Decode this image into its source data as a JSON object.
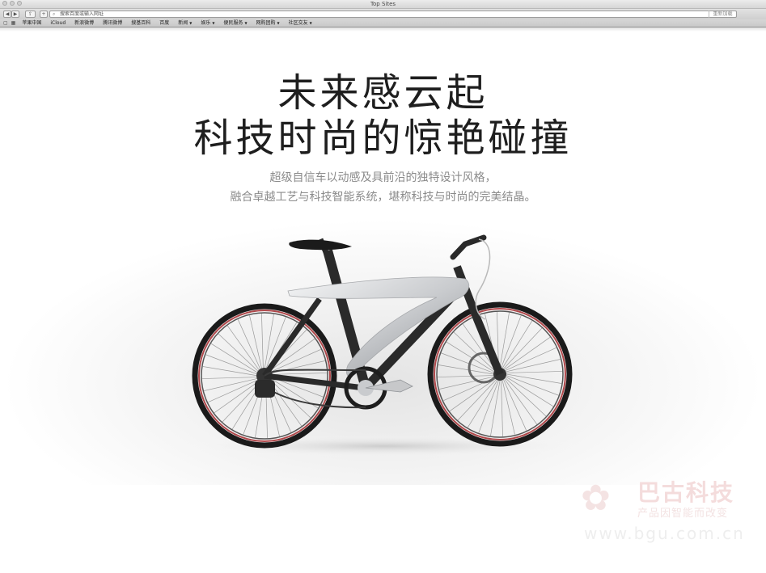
{
  "window": {
    "title": "Top Sites"
  },
  "toolbar": {
    "back_glyph": "◀",
    "forward_glyph": "▶",
    "share_glyph": "⇪",
    "add_glyph": "+",
    "address_placeholder": "搜索百度或输入网址",
    "right_button": "重新加载"
  },
  "bookmarks": {
    "items": [
      {
        "label": "苹果中国",
        "menu": false
      },
      {
        "label": "iCloud",
        "menu": false
      },
      {
        "label": "新浪微博",
        "menu": false
      },
      {
        "label": "腾讯微博",
        "menu": false
      },
      {
        "label": "搜基百科",
        "menu": false
      },
      {
        "label": "百度",
        "menu": false
      },
      {
        "label": "新闻",
        "menu": true
      },
      {
        "label": "娱乐",
        "menu": true
      },
      {
        "label": "便民服务",
        "menu": true
      },
      {
        "label": "网购团购",
        "menu": true
      },
      {
        "label": "社区交友",
        "menu": true
      }
    ]
  },
  "hero": {
    "headline_line1": "未来感云起",
    "headline_line2": "科技时尚的惊艳碰撞",
    "subtitle_line1": "超级自信车以动感及具前沿的独特设计风格，",
    "subtitle_line2": "融合卓越工艺与科技智能系统，堪称科技与时尚的完美结晶。"
  },
  "watermark": {
    "brand": "巴古科技",
    "slogan": "产品因智能而改变",
    "url": "www.bgu.com.cn"
  },
  "colors": {
    "rim_accent": "#b0474a",
    "frame": "#2a2a2a",
    "frame_silver": "#d9dadc",
    "headline": "#1e1e1e",
    "subtitle": "#8b8b8b"
  }
}
